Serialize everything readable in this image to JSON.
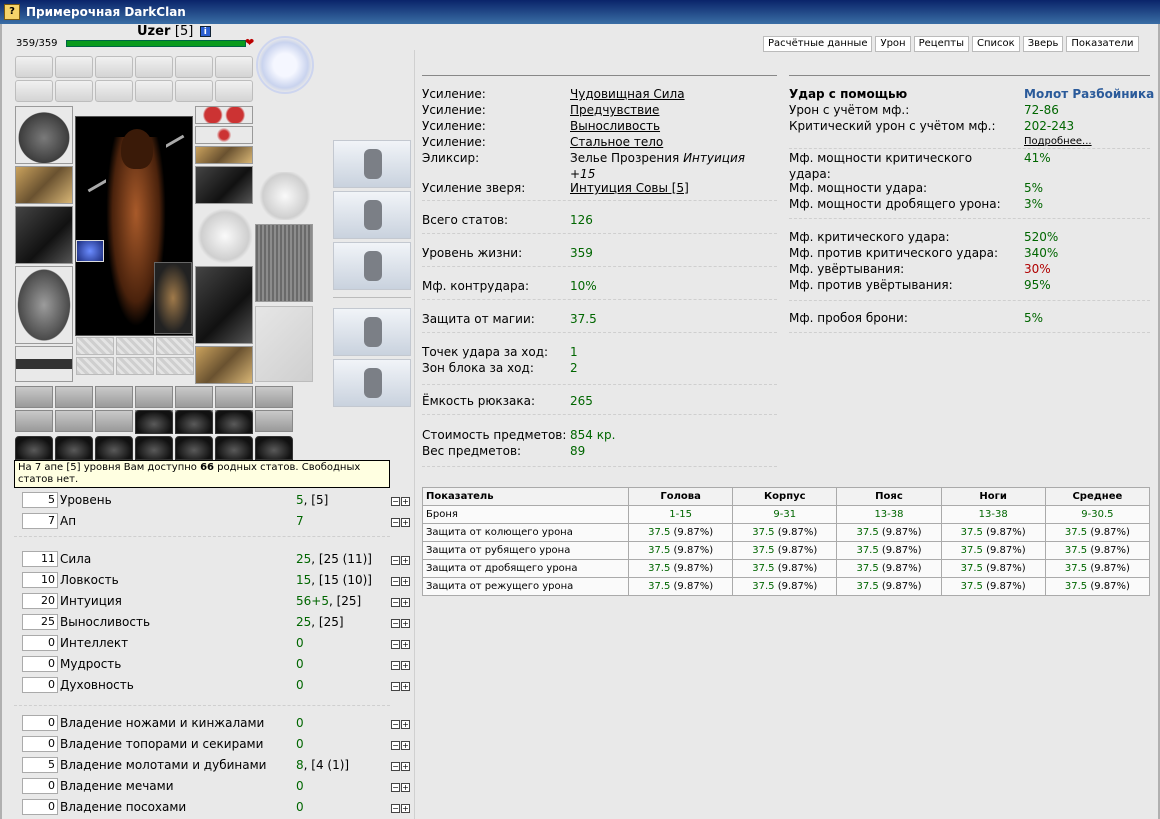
{
  "window": {
    "title": "Примерочная DarkClan"
  },
  "character": {
    "nick": "Uzer",
    "level": "[5]",
    "info_icon": "i",
    "hp": "359/359"
  },
  "tabs": [
    "Расчётные данные",
    "Урон",
    "Рецепты",
    "Список",
    "Зверь",
    "Показатели"
  ],
  "tooltip": {
    "pre": "На 7 апе [5] уровня Вам доступно ",
    "bold": "66",
    "post": " родных статов. Свободных статов нет."
  },
  "stats_main": [
    {
      "box": "5",
      "name": "Уровень",
      "val": "5",
      "extra": ", [5]"
    },
    {
      "box": "7",
      "name": "Ап",
      "val": "7",
      "extra": ""
    }
  ],
  "stats_attr": [
    {
      "box": "11",
      "name": "Сила",
      "val": "25",
      "extra": ", [25 (11)]"
    },
    {
      "box": "10",
      "name": "Ловкость",
      "val": "15",
      "extra": ", [15 (10)]"
    },
    {
      "box": "20",
      "name": "Интуиция",
      "val": "56+5",
      "extra": ", [25]"
    },
    {
      "box": "25",
      "name": "Выносливость",
      "val": "25",
      "extra": ", [25]"
    },
    {
      "box": "0",
      "name": "Интеллект",
      "val": "0",
      "extra": ""
    },
    {
      "box": "0",
      "name": "Мудрость",
      "val": "0",
      "extra": ""
    },
    {
      "box": "0",
      "name": "Духовность",
      "val": "0",
      "extra": ""
    }
  ],
  "stats_skills": [
    {
      "box": "0",
      "name": "Владение ножами и кинжалами",
      "val": "0",
      "extra": ""
    },
    {
      "box": "0",
      "name": "Владение топорами и секирами",
      "val": "0",
      "extra": ""
    },
    {
      "box": "5",
      "name": "Владение молотами и дубинами",
      "val": "8",
      "extra": ", [4 (1)]"
    },
    {
      "box": "0",
      "name": "Владение мечами",
      "val": "0",
      "extra": ""
    },
    {
      "box": "0",
      "name": "Владение посохами",
      "val": "0",
      "extra": ""
    }
  ],
  "buffs": [
    {
      "label": "Усиление:",
      "value": "Чудовищная Сила"
    },
    {
      "label": "Усиление:",
      "value": "Предчувствие"
    },
    {
      "label": "Усиление:",
      "value": "Выносливость"
    },
    {
      "label": "Усиление:",
      "value": "Стальное тело"
    }
  ],
  "elixir": {
    "label": "Эликсир:",
    "value": "Зелье Прозрения",
    "italic": "Интуиция +15"
  },
  "pet_buff": {
    "label": "Усиление зверя:",
    "value": "Интуиция Совы [5]"
  },
  "mid_stats": [
    {
      "label": "Всего статов:",
      "value": "126"
    },
    {
      "label": "Уровень жизни:",
      "value": "359"
    },
    {
      "label": "Мф. контрудара:",
      "value": "10%"
    },
    {
      "label": "Защита от магии:",
      "value": "37.5"
    }
  ],
  "hits": [
    {
      "label": "Точек удара за ход:",
      "value": "1"
    },
    {
      "label": "Зон блока за ход:",
      "value": "2"
    }
  ],
  "backpack": {
    "label": "Ёмкость рюкзака:",
    "value": "265"
  },
  "cost": [
    {
      "label": "Стоимость предметов:",
      "value": "854 кр."
    },
    {
      "label": "Вес предметов:",
      "value": "89"
    }
  ],
  "weapon": {
    "label": "Удар с помощью",
    "name": "Молот Разбойника"
  },
  "damage": [
    {
      "label": "Урон с учётом мф.:",
      "value": "72-86"
    },
    {
      "label": "Критический урон с учётом мф.:",
      "value": "202-243"
    }
  ],
  "more_link": "Подробнее...",
  "mf_power": [
    {
      "label": "Мф. мощности критического удара:",
      "value": "41%"
    },
    {
      "label": "Мф. мощности удара:",
      "value": "5%"
    },
    {
      "label": "Мф. мощности дробящего урона:",
      "value": "3%"
    }
  ],
  "mf_crit": [
    {
      "label": "Мф. критического удара:",
      "value": "520%",
      "red": false
    },
    {
      "label": "Мф. против критического удара:",
      "value": "340%",
      "red": false
    },
    {
      "label": "Мф. увёртывания:",
      "value": "30%",
      "red": true
    },
    {
      "label": "Мф. против увёртывания:",
      "value": "95%",
      "red": false
    }
  ],
  "mf_pierce": {
    "label": "Мф. пробоя брони:",
    "value": "5%"
  },
  "armor_table": {
    "headers": [
      "Показатель",
      "Голова",
      "Корпус",
      "Пояс",
      "Ноги",
      "Среднее"
    ],
    "rows": [
      [
        "Броня",
        "1-15",
        "9-31",
        "13-38",
        "13-38",
        "9-30.5"
      ],
      [
        "Защита от колющего урона",
        "37.5",
        "37.5",
        "37.5",
        "37.5",
        "37.5"
      ],
      [
        "Защита от рубящего урона",
        "37.5",
        "37.5",
        "37.5",
        "37.5",
        "37.5"
      ],
      [
        "Защита от дробящего урона",
        "37.5",
        "37.5",
        "37.5",
        "37.5",
        "37.5"
      ],
      [
        "Защита от режущего урона",
        "37.5",
        "37.5",
        "37.5",
        "37.5",
        "37.5"
      ]
    ],
    "pct": "(9.87%)"
  }
}
